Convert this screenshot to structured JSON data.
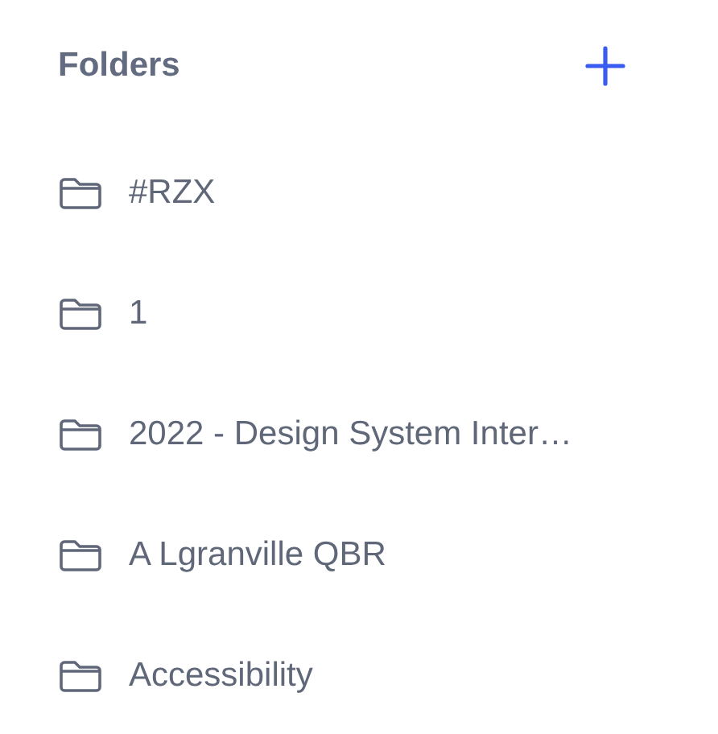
{
  "header": {
    "title": "Folders"
  },
  "folders": [
    {
      "name": "#RZX"
    },
    {
      "name": "1"
    },
    {
      "name": "2022 - Design System Inter…"
    },
    {
      "name": "A Lgranville QBR"
    },
    {
      "name": "Accessibility"
    }
  ]
}
